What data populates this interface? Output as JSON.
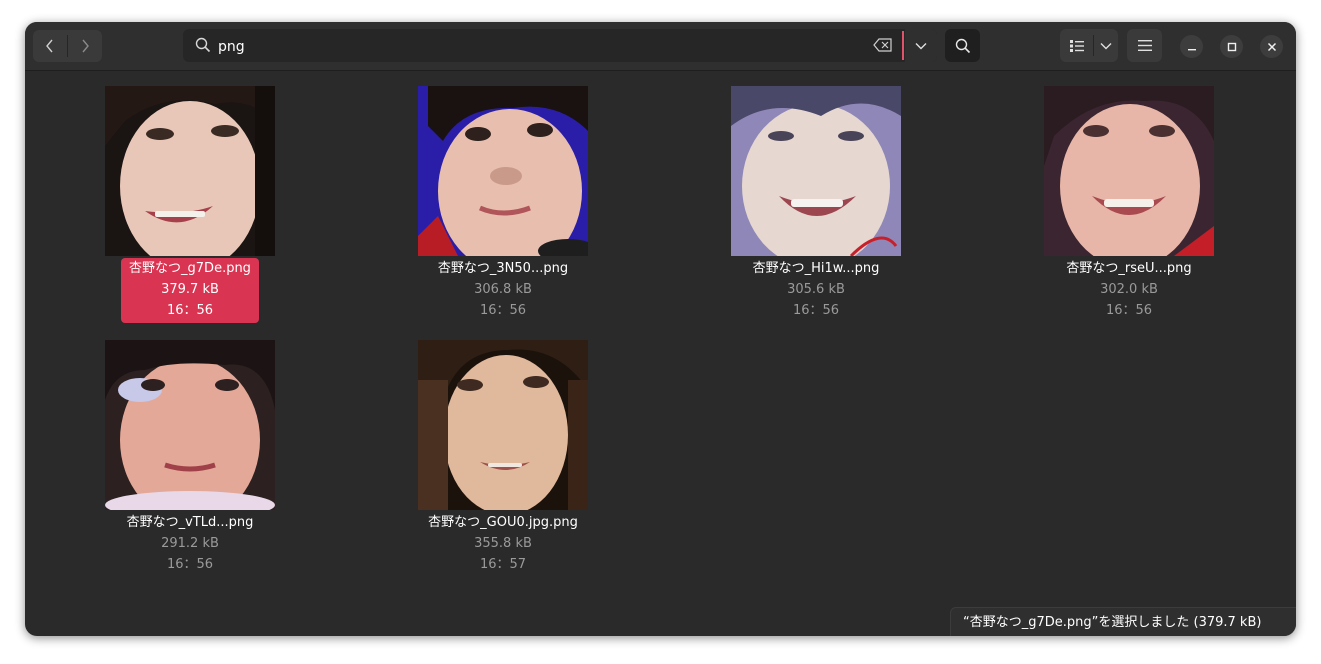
{
  "toolbar": {
    "back_icon": "chevron-left-icon",
    "forward_icon": "chevron-right-icon",
    "search_icon": "search-icon",
    "search_value": "png",
    "clear_icon": "backspace-clear-icon",
    "search_options_icon": "chevron-down-icon",
    "search_button_icon": "search-icon",
    "view_icon": "list-view-icon",
    "view_dropdown_icon": "chevron-down-icon",
    "menu_icon": "hamburger-menu-icon"
  },
  "window_controls": {
    "minimize": "–",
    "maximize": "□",
    "close": "✕"
  },
  "files": [
    {
      "name": "杏野なつ_g7De.png",
      "size": "379.7 kB",
      "time": "16：56",
      "selected": true
    },
    {
      "name": "杏野なつ_3N50...png",
      "size": "306.8 kB",
      "time": "16：56",
      "selected": false
    },
    {
      "name": "杏野なつ_Hi1w...png",
      "size": "305.6 kB",
      "time": "16：56",
      "selected": false
    },
    {
      "name": "杏野なつ_rseU...png",
      "size": "302.0 kB",
      "time": "16：56",
      "selected": false
    },
    {
      "name": "杏野なつ_vTLd...png",
      "size": "291.2 kB",
      "time": "16：56",
      "selected": false
    },
    {
      "name": "杏野なつ_GOU0.jpg.png",
      "size": "355.8 kB",
      "time": "16：57",
      "selected": false
    }
  ],
  "status_bar": {
    "text": "“杏野なつ_g7De.png”を選択しました (379.7 kB)"
  },
  "colors": {
    "accent": "#d93451",
    "window_bg": "#2a2a2a",
    "header_bg": "#2f2f2f"
  }
}
